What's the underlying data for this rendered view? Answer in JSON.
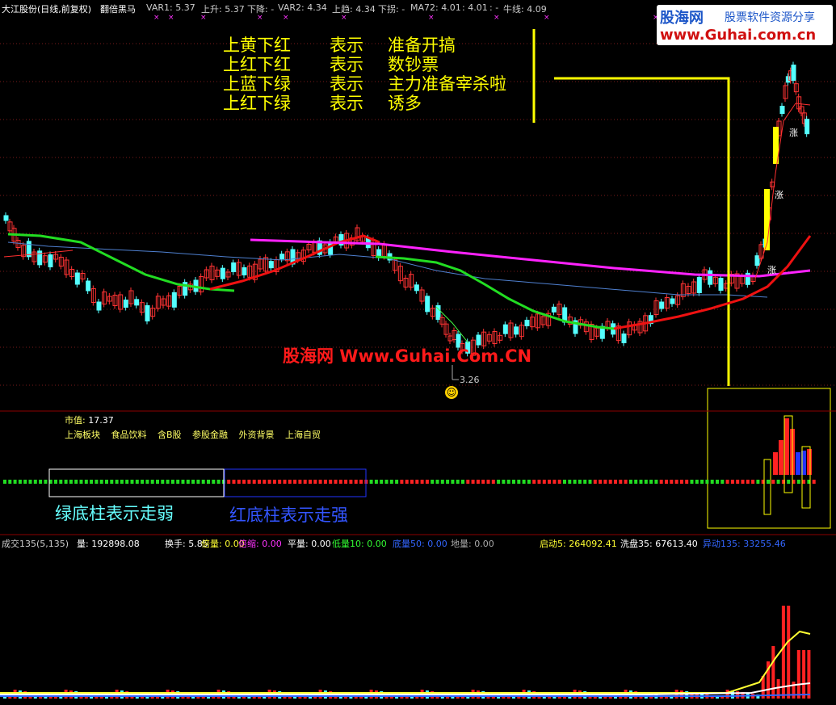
{
  "header": {
    "title": "大江股份(日线,前复权)",
    "indicator_name": "翻倍黑马",
    "items": [
      {
        "label": "VAR1:",
        "value": "5.37",
        "color": "#ff3333"
      },
      {
        "label": "上升:",
        "value": "5.37",
        "color": "#ff3333"
      },
      {
        "label": "下降:",
        "value": "-",
        "color": "#33ff33"
      },
      {
        "label": "VAR2:",
        "value": "4.34",
        "color": "#ff3333"
      },
      {
        "label": "上趋:",
        "value": "4.34",
        "color": "#ff3333"
      },
      {
        "label": "下拐:",
        "value": "-",
        "color": "#33ff33"
      },
      {
        "label": "MA72:",
        "value": "4.01",
        "color": "#ffffff"
      },
      {
        "label": ":",
        "value": "4.01",
        "color": "#ff3333"
      },
      {
        "label": ":",
        "value": "-",
        "color": "#33ff33"
      },
      {
        "label": "牛线:",
        "value": "4.09",
        "color": "#ff33ff"
      }
    ]
  },
  "legend": [
    {
      "pattern": "上黄下红",
      "verb": "表示",
      "meaning": "准备开搞"
    },
    {
      "pattern": "上红下红",
      "verb": "表示",
      "meaning": "数钞票"
    },
    {
      "pattern": "上蓝下绿",
      "verb": "表示",
      "meaning": "主力准备宰杀啦"
    },
    {
      "pattern": "上红下绿",
      "verb": "表示",
      "meaning": "诱多"
    }
  ],
  "logo": {
    "brand": "股海网",
    "slogan": "股票软件资源分享",
    "url": "www.Guhai.com.cn"
  },
  "watermark": "股海网 Www.Guhai.Com.CN",
  "price_low_label": "3.26",
  "rise_marker": "涨",
  "mid_panel": {
    "market_cap_label": "市值:",
    "market_cap_value": "17.37",
    "tags": [
      "上海板块",
      "食品饮料",
      "含B股",
      "参股金融",
      "外资背景",
      "上海自贸"
    ],
    "green_label": "绿底柱表示走弱",
    "red_label": "红底柱表示走强"
  },
  "volume_panel": {
    "name": "成交135(5,135)",
    "items": [
      {
        "label": "量:",
        "value": "192898.08",
        "color": "#ffffff"
      },
      {
        "label": "换手:",
        "value": "5.85",
        "color": "#ffffff"
      },
      {
        "label": "倍量:",
        "value": "0.00",
        "color": "#ffff33"
      },
      {
        "label": "倍缩:",
        "value": "0.00",
        "color": "#ff33ff"
      },
      {
        "label": "平量:",
        "value": "0.00",
        "color": "#ffffff"
      },
      {
        "label": "低量10:",
        "value": "0.00",
        "color": "#33ff33"
      },
      {
        "label": "底量50:",
        "value": "0.00",
        "color": "#3366ff"
      },
      {
        "label": "地量:",
        "value": "0.00",
        "color": "#aaaaaa"
      },
      {
        "label": "启动5:",
        "value": "264092.41",
        "color": "#ffff33"
      },
      {
        "label": "洗盘35:",
        "value": "67613.40",
        "color": "#ffffff"
      },
      {
        "label": "异动135:",
        "value": "33255.46",
        "color": "#3366ff"
      }
    ]
  },
  "colors": {
    "up": "#ff3333",
    "down": "#54ffff",
    "ma_green": "#22dd22",
    "ma_red": "#ee1111",
    "ma_magenta": "#ff22ff",
    "ma_blue": "#4f80d0",
    "highlight": "#ffff00"
  }
}
